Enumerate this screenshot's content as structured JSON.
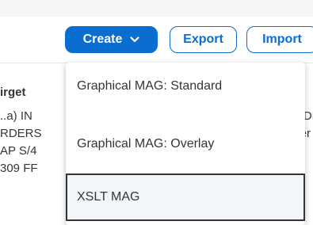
{
  "toolbar": {
    "create_label": "Create",
    "export_label": "Export",
    "import_label": "Import"
  },
  "background": {
    "column_header": "irget",
    "rows_left": [
      "..a) IN",
      "RDERS",
      "AP S/4",
      "309 FF"
    ],
    "rows_right": [
      "RDE",
      "ller /"
    ]
  },
  "create_menu": {
    "items": [
      {
        "label": "Graphical MAG: Standard"
      },
      {
        "label": "Graphical MAG: Overlay"
      },
      {
        "label": "XSLT MAG",
        "focused": true
      }
    ]
  },
  "colors": {
    "accent": "#0a6ed1",
    "text": "#32363a"
  }
}
